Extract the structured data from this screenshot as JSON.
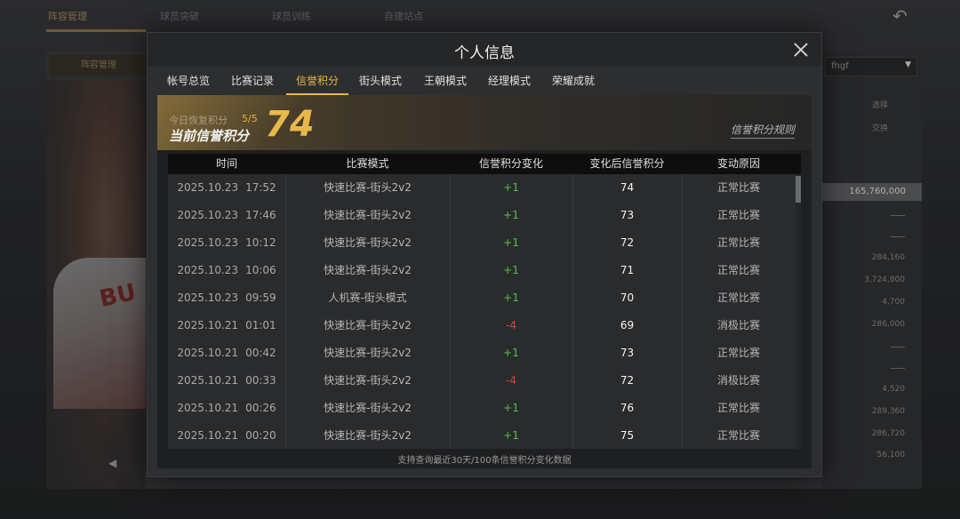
{
  "background": {
    "nav": [
      "阵容管理",
      "球员突破",
      "球员训练",
      "自建站点"
    ],
    "sub_tab": "阵容管理",
    "dropdown_value": "fhgf",
    "buttons": [
      "选择",
      "交换"
    ],
    "highlight_value": "165,760,000",
    "numbers": [
      "284,160",
      "3,724,800",
      "4,700",
      "286,000",
      "4,520",
      "289,360",
      "286,720",
      "56,100"
    ],
    "jersey_text": "BU"
  },
  "modal": {
    "title": "个人信息",
    "tabs": [
      "帐号总览",
      "比赛记录",
      "信誉积分",
      "街头模式",
      "王朝模式",
      "经理模式",
      "荣耀成就"
    ],
    "active_tab_index": 2
  },
  "score": {
    "recover_label": "今日恢复积分",
    "recover_count": "5/5",
    "label": "当前信誉积分",
    "value": "74",
    "rules_link": "信誉积分规则"
  },
  "table": {
    "headers": [
      "时间",
      "比赛模式",
      "信誉积分变化",
      "变化后信誉积分",
      "变动原因"
    ],
    "rows": [
      {
        "date": "2025.10.23",
        "time": "17:52",
        "mode": "快速比赛-街头2v2",
        "delta": "+1",
        "after": "74",
        "reason": "正常比赛"
      },
      {
        "date": "2025.10.23",
        "time": "17:46",
        "mode": "快速比赛-街头2v2",
        "delta": "+1",
        "after": "73",
        "reason": "正常比赛"
      },
      {
        "date": "2025.10.23",
        "time": "10:12",
        "mode": "快速比赛-街头2v2",
        "delta": "+1",
        "after": "72",
        "reason": "正常比赛"
      },
      {
        "date": "2025.10.23",
        "time": "10:06",
        "mode": "快速比赛-街头2v2",
        "delta": "+1",
        "after": "71",
        "reason": "正常比赛"
      },
      {
        "date": "2025.10.23",
        "time": "09:59",
        "mode": "人机赛-街头模式",
        "delta": "+1",
        "after": "70",
        "reason": "正常比赛"
      },
      {
        "date": "2025.10.21",
        "time": "01:01",
        "mode": "快速比赛-街头2v2",
        "delta": "-4",
        "after": "69",
        "reason": "消极比赛"
      },
      {
        "date": "2025.10.21",
        "time": "00:42",
        "mode": "快速比赛-街头2v2",
        "delta": "+1",
        "after": "73",
        "reason": "正常比赛"
      },
      {
        "date": "2025.10.21",
        "time": "00:33",
        "mode": "快速比赛-街头2v2",
        "delta": "-4",
        "after": "72",
        "reason": "消极比赛"
      },
      {
        "date": "2025.10.21",
        "time": "00:26",
        "mode": "快速比赛-街头2v2",
        "delta": "+1",
        "after": "76",
        "reason": "正常比赛"
      },
      {
        "date": "2025.10.21",
        "time": "00:20",
        "mode": "快速比赛-街头2v2",
        "delta": "+1",
        "after": "75",
        "reason": "正常比赛"
      }
    ],
    "footer_note": "支持查询最近30天/100条信誉积分变化数据"
  },
  "colors": {
    "accent": "#e8b84a",
    "positive": "#4fc24a",
    "negative": "#d8413a"
  }
}
